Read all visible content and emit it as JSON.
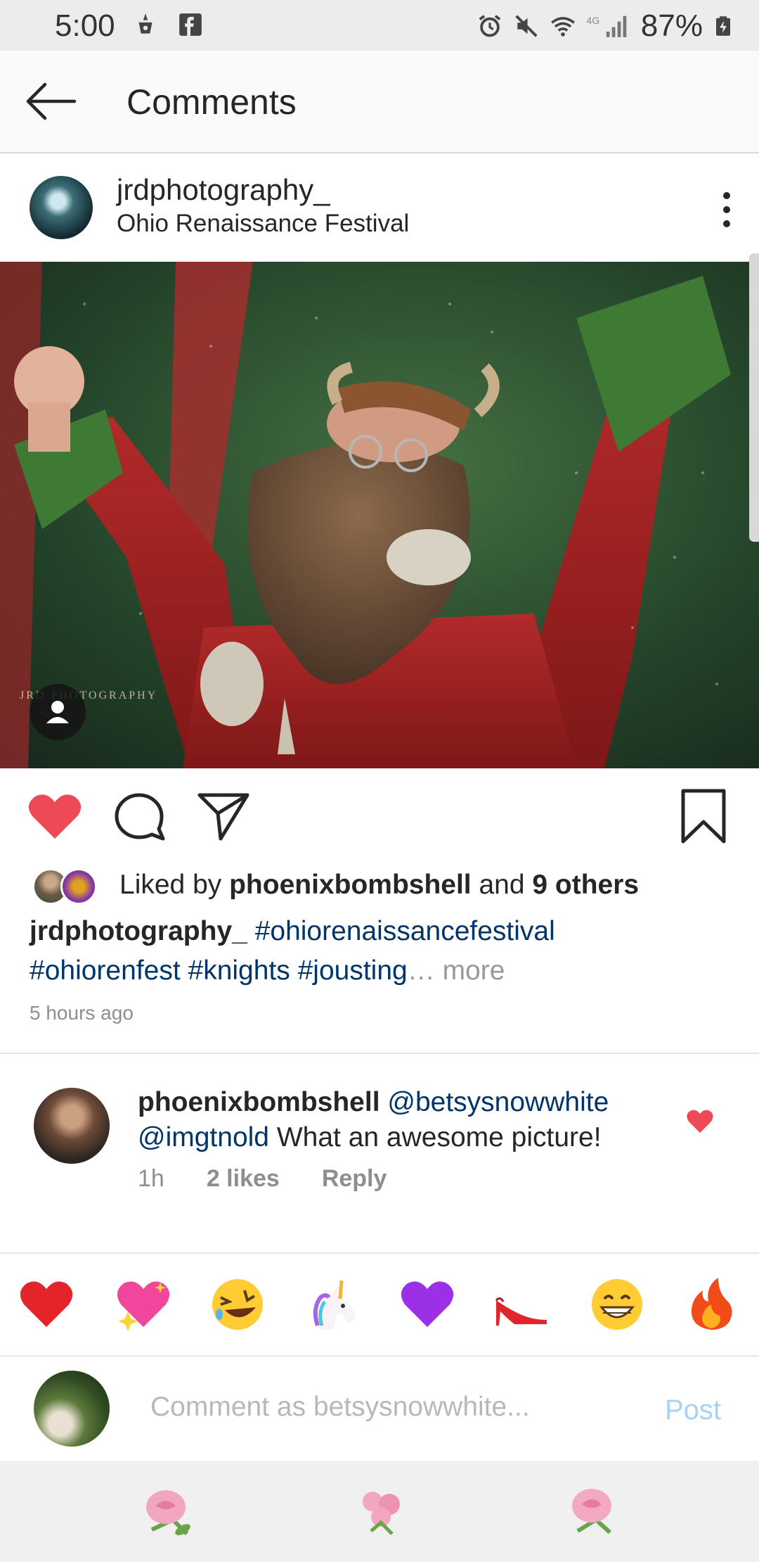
{
  "status_bar": {
    "time": "5:00",
    "battery": "87%",
    "network": "4G"
  },
  "header": {
    "title": "Comments"
  },
  "post": {
    "username": "jrdphotography_",
    "location": "Ohio Renaissance Festival",
    "watermark": "JRD PHOTOGRAPHY"
  },
  "likes": {
    "prefix": "Liked by ",
    "user": "phoenixbombshell",
    "middle": " and ",
    "others": "9 others"
  },
  "caption": {
    "username": "jrdphotography_",
    "tag1": "#ohiorenaissancefestival",
    "tag2": "#ohiorenfest",
    "tag3": "#knights",
    "tag4": "#jousting",
    "ellipsis": "…",
    "more": " more",
    "timestamp": "5 hours ago"
  },
  "comment": {
    "username": "phoenixbombshell",
    "mention1": "@betsysnowwhite",
    "mention2": "@imgtnold",
    "text": " What an awesome picture!",
    "time": "1h",
    "likes": "2 likes",
    "reply": "Reply"
  },
  "emoji_bar": {
    "emojis": [
      "red-heart",
      "sparkling-heart",
      "laughing-face",
      "unicorn",
      "purple-heart",
      "high-heel",
      "grinning-face",
      "fire"
    ]
  },
  "input": {
    "placeholder": "Comment as betsysnowwhite...",
    "post_label": "Post"
  },
  "colors": {
    "like_red": "#ed4956",
    "link_blue": "#003569",
    "post_button": "#a8d2f5",
    "muted": "#8e8e8e"
  }
}
